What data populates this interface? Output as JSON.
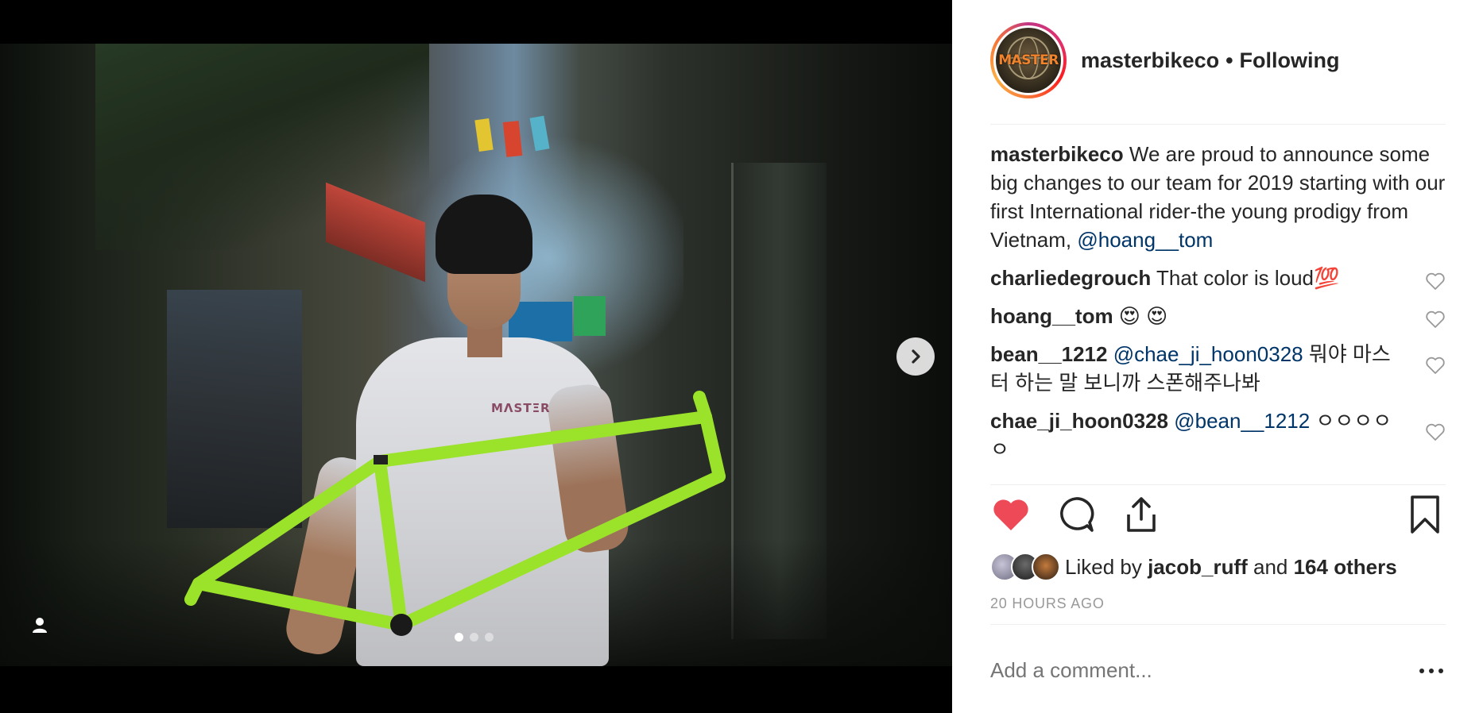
{
  "post": {
    "author": "masterbikeco",
    "separator": "•",
    "follow_status": "Following",
    "avatar_text": "MASTER",
    "shirt_logo_text": "MΛSTΞR",
    "caption_text": " We are proud to announce some big changes to our team for 2019 starting with our first International rider-the young prodigy from Vietnam, ",
    "caption_mention": "@hoang__tom",
    "comments": [
      {
        "user": "charliedegrouch",
        "text": " That color is loud💯"
      },
      {
        "user": "hoang__tom",
        "text": " 😍 😍"
      },
      {
        "user": "bean__1212",
        "mention": "@chae_ji_hoon0328",
        "text": " 뭐야 마스터 하는 말 보니까 스폰해주나봐"
      },
      {
        "user": "chae_ji_hoon0328",
        "mention": "@bean__1212",
        "text": " ㅇㅇㅇㅇㅇ"
      }
    ],
    "likes": {
      "prefix": "Liked by ",
      "user": "jacob_ruff",
      "middle": " and ",
      "others": "164 others"
    },
    "time_ago": "20 HOURS AGO",
    "comment_placeholder": "Add a comment...",
    "liked": true,
    "carousel": {
      "count": 3,
      "active_index": 0
    }
  },
  "icons": {
    "like": "heart-filled-icon",
    "comment": "comment-icon",
    "share": "share-icon",
    "save": "bookmark-icon",
    "next": "chevron-right-icon",
    "tag": "user-tag-icon",
    "more": "more-options-icon"
  },
  "colors": {
    "like_red": "#ed4956",
    "mention_blue": "#003569",
    "frame_green": "#9be22a",
    "muted_text": "#999999"
  }
}
